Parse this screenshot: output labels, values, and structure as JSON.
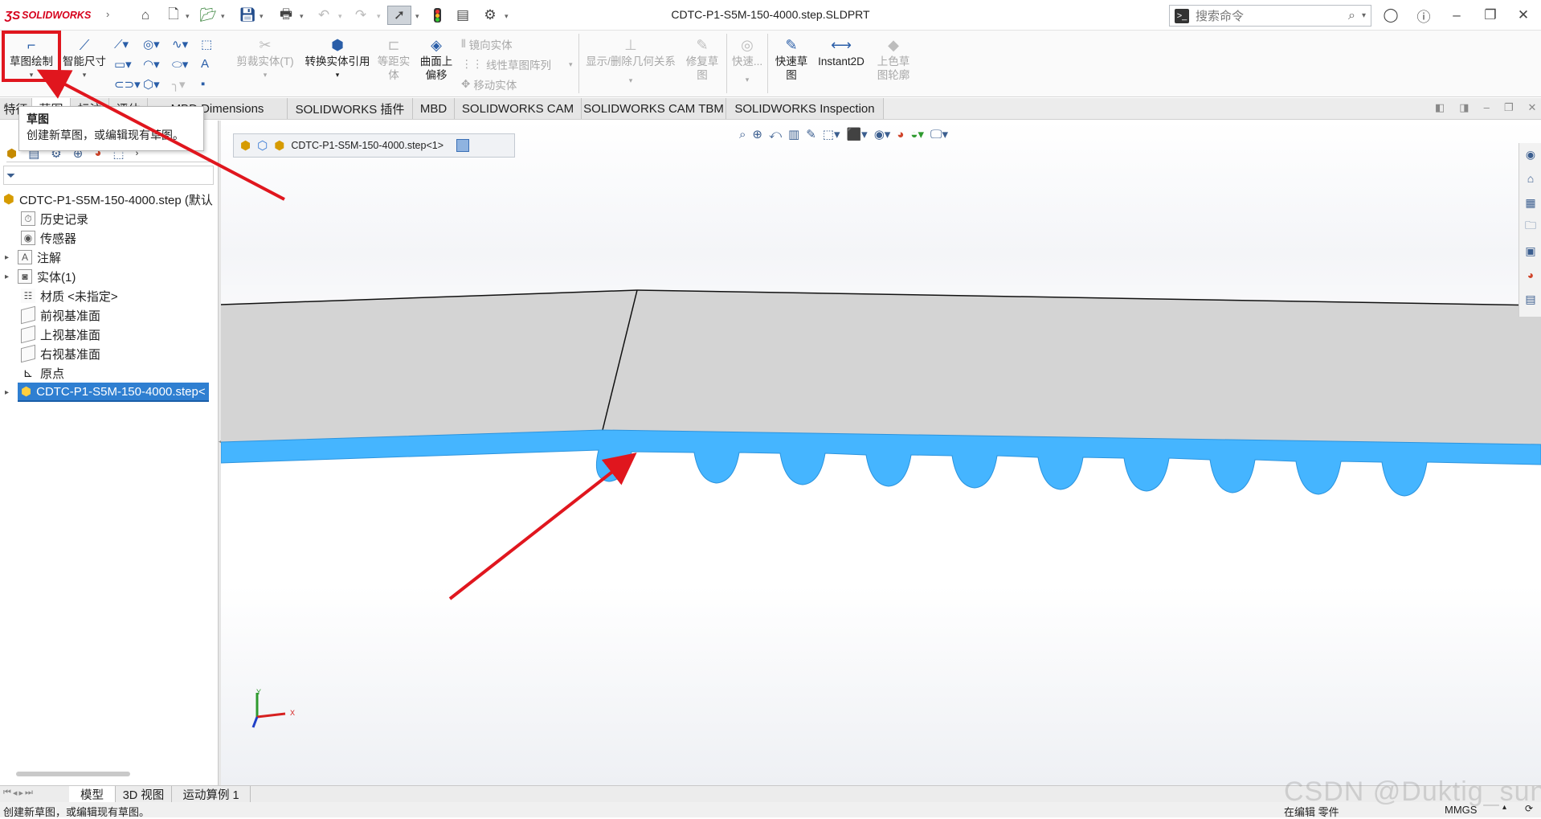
{
  "app": {
    "brand": "SOLIDWORKS",
    "doc_title": "CDTC-P1-S5M-150-4000.step.SLDPRT",
    "search_placeholder": "搜索命令"
  },
  "quick_access": [
    "home-icon",
    "new-document-icon",
    "open-folder-icon",
    "save-icon",
    "print-icon",
    "undo-icon",
    "redo-icon",
    "select-pointer-icon",
    "traffic-light-icon",
    "file-properties-icon",
    "options-gear-icon"
  ],
  "window_controls": [
    "account-icon",
    "help-icon",
    "minimize-icon",
    "restore-icon",
    "close-icon"
  ],
  "ribbon": {
    "sketch": "草图绘制",
    "smart_dim": "智能尺寸",
    "trim": "剪裁实体(T)",
    "convert": "转换实体引用",
    "offset_l1": "等距实",
    "offset_l2": "体",
    "surface_offset_l1": "曲面上",
    "surface_offset_l2": "偏移",
    "mirror": "镜向实体",
    "linear_pattern": "线性草图阵列",
    "move": "移动实体",
    "display_relations": "显示/删除几何关系",
    "repair_l1": "修复草",
    "repair_l2": "图",
    "quick_snap": "快速...",
    "rapid_sketch_l1": "快速草",
    "rapid_sketch_l2": "图",
    "instant2d": "Instant2D",
    "shaded_l1": "上色草",
    "shaded_l2": "图轮廓"
  },
  "tabs": [
    "特征",
    "草图",
    "标注",
    "评估",
    "MBD Dimensions",
    "SOLIDWORKS 插件",
    "MBD",
    "SOLIDWORKS CAM",
    "SOLIDWORKS CAM TBM",
    "SOLIDWORKS Inspection"
  ],
  "tooltip": {
    "title": "草图",
    "text": "创建新草图，或编辑现有草图。"
  },
  "feature_tree": {
    "root": "CDTC-P1-S5M-150-4000.step (默认",
    "items": [
      "历史记录",
      "传感器",
      "注解",
      "实体(1)",
      "材质 <未指定>",
      "前视基准面",
      "上视基准面",
      "右视基准面",
      "原点",
      "CDTC-P1-S5M-150-4000.step<"
    ]
  },
  "breadcrumb": "CDTC-P1-S5M-150-4000.step<1>",
  "triad": {
    "x": "X",
    "y": "Y"
  },
  "bottom_tabs": [
    "模型",
    "3D 视图",
    "运动算例 1"
  ],
  "status": {
    "left": "创建新草图，或编辑现有草图。",
    "mode": "在编辑 零件",
    "units": "MMGS"
  },
  "watermark": "CSDN @Duktig_sun",
  "colors": {
    "brand_red": "#d6001c",
    "model_face": "#d4d4d4",
    "selected_face": "#45b5ff",
    "annotation_red": "#e0161e",
    "selection_highlight": "#2f7fd1"
  }
}
